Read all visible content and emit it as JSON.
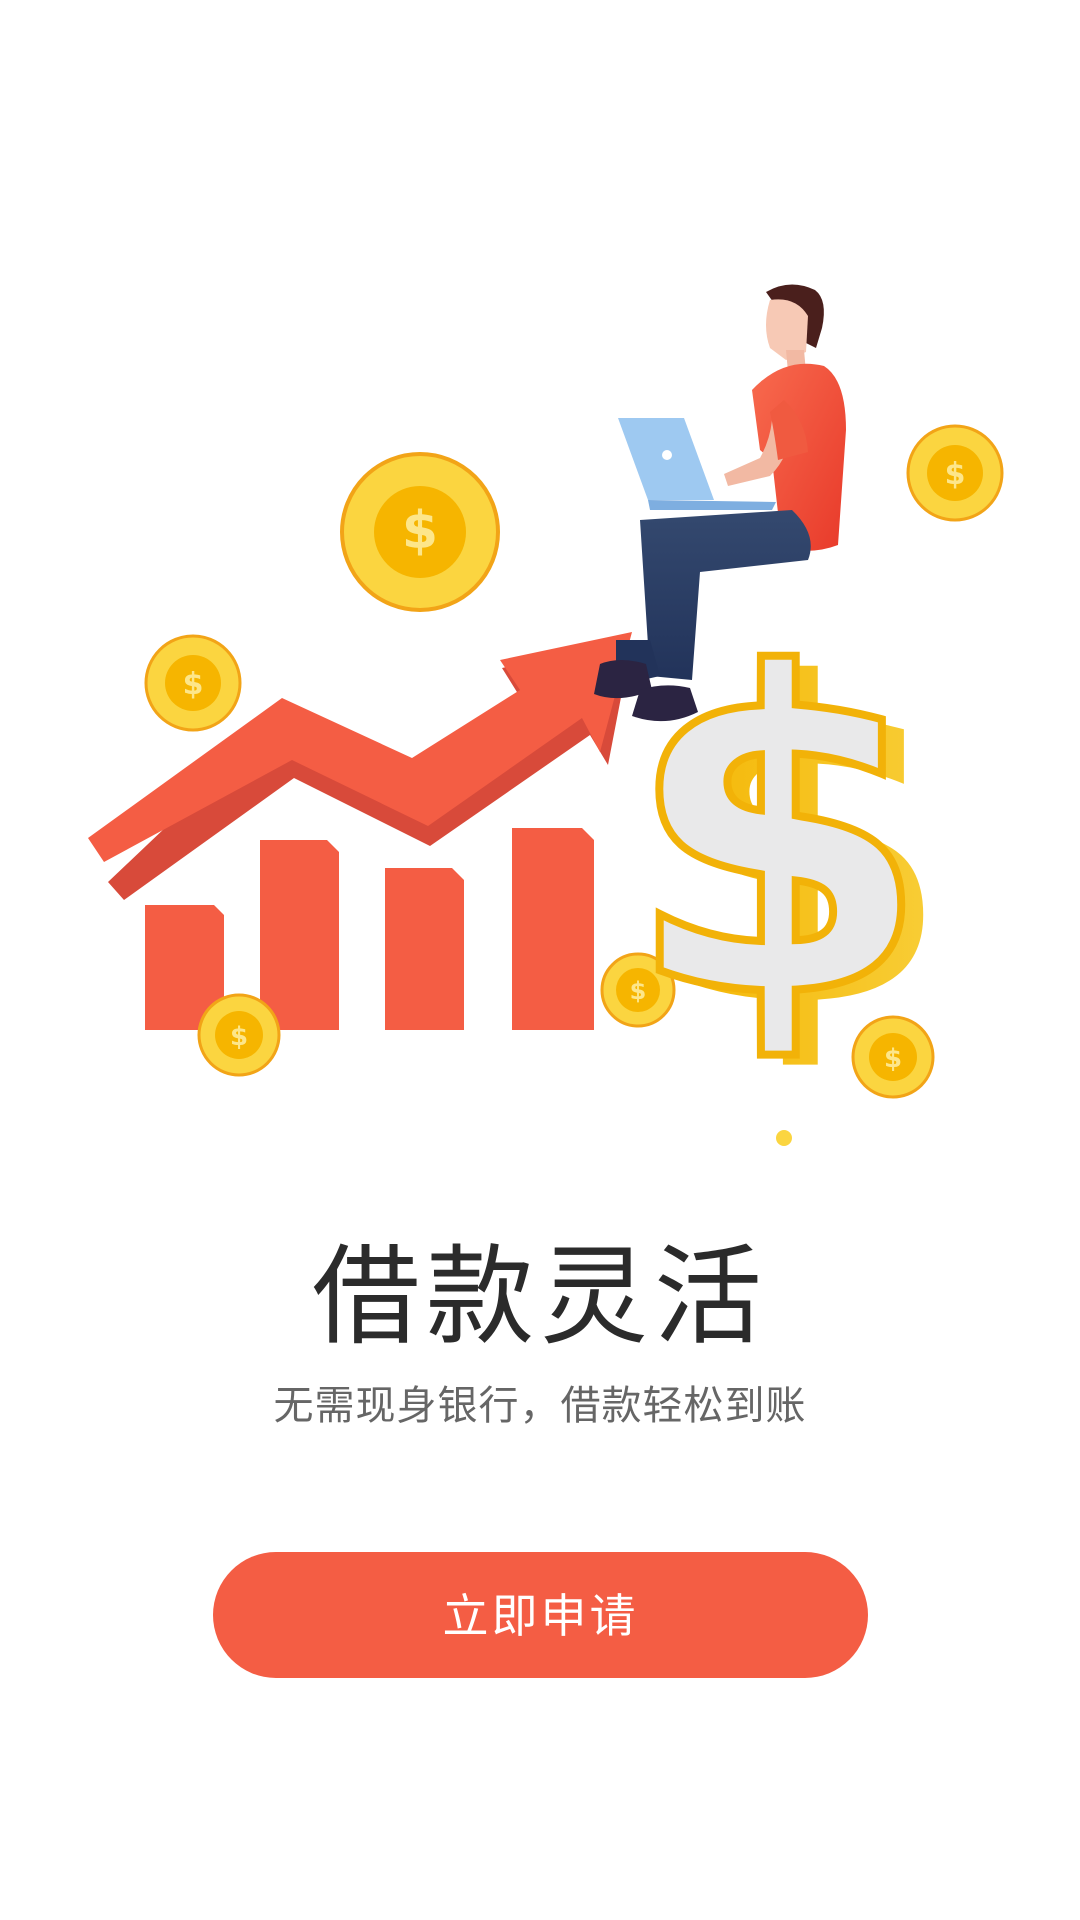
{
  "hero": {
    "illustration": "loan-growth-illustration"
  },
  "main": {
    "title": "借款灵活",
    "subtitle": "无需现身银行，借款轻松到账",
    "apply_button_label": "立即申请"
  },
  "colors": {
    "accent": "#f45d44",
    "coin": "#fbd540",
    "coin_inner": "#f6b500",
    "title": "#2b2b2b",
    "subtitle": "#666666"
  }
}
